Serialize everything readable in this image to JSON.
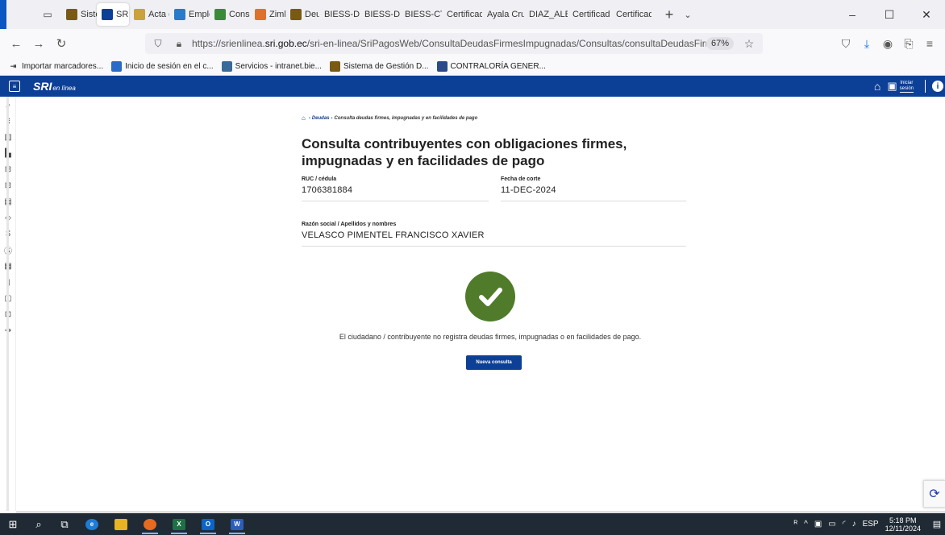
{
  "browser": {
    "tabs": [
      {
        "label": "Sistem",
        "icon": "sri-shield-icon",
        "color": "#7a5a12",
        "active": false
      },
      {
        "label": "SRI",
        "icon": "sri-logo-icon",
        "color": "#0c3f96",
        "active": true
      },
      {
        "label": "Acta c",
        "icon": "feather-icon",
        "color": "#c9a23a",
        "active": false
      },
      {
        "label": "Emple",
        "icon": "people-icon",
        "color": "#2a7ac9",
        "active": false
      },
      {
        "label": "Consu",
        "icon": "arrows-icon",
        "color": "#3a8a3a",
        "active": false
      },
      {
        "label": "Zimbr",
        "icon": "zimbra-icon",
        "color": "#e0712a",
        "active": false
      },
      {
        "label": "Deud",
        "icon": "sri-shield-icon",
        "color": "#7a5a12",
        "active": false
      },
      {
        "label": "BIESS-DG",
        "icon": "",
        "color": "",
        "active": false
      },
      {
        "label": "BIESS-DG",
        "icon": "",
        "color": "",
        "active": false
      },
      {
        "label": "BIESS-CTE",
        "icon": "",
        "color": "",
        "active": false
      },
      {
        "label": "Certificad",
        "icon": "",
        "color": "",
        "active": false
      },
      {
        "label": "Ayala Cru",
        "icon": "",
        "color": "",
        "active": false
      },
      {
        "label": "DIAZ_ALB",
        "icon": "",
        "color": "",
        "active": false
      },
      {
        "label": "Certificad",
        "icon": "",
        "color": "",
        "active": false
      },
      {
        "label": "Certificad",
        "icon": "",
        "color": "",
        "active": false
      }
    ],
    "url_prefix": "https://srienlinea.",
    "url_domain": "sri.gob.ec",
    "url_path": "/sri-en-linea/SriPagosWeb/ConsultaDeudasFirmesImpugnadas/Consultas/consultaDeudasFirmesImpugnadas",
    "zoom": "67%",
    "bookmarks": [
      {
        "label": "Importar marcadores...",
        "icon": "import-icon",
        "color": ""
      },
      {
        "label": "Inicio de sesión en el c...",
        "icon": "zimbra-icon",
        "color": "#2a6ac9"
      },
      {
        "label": "Servicios - intranet.bie...",
        "icon": "folder-icon",
        "color": "#3a6a9a"
      },
      {
        "label": "Sistema de Gestión D...",
        "icon": "sri-shield-icon",
        "color": "#7a5a12"
      },
      {
        "label": "CONTRALORÍA GENER...",
        "icon": "contraloria-icon",
        "color": "#2a4a8a"
      }
    ]
  },
  "sri": {
    "logo": "SRI",
    "logo_sub": "en línea",
    "login_label_1": "Iniciar",
    "login_label_2": "sesión"
  },
  "content": {
    "breadcrumb": {
      "parent": "Deudas",
      "current": "Consulta deudas firmes, impugnadas y en facilidades de pago"
    },
    "title": "Consulta contribuyentes con obligaciones firmes, impugnadas y en facilidades de pago",
    "ruc_label": "RUC / cédula",
    "ruc_value": "1706381884",
    "fecha_label": "Fecha de corte",
    "fecha_value": "11-DEC-2024",
    "razon_label": "Razón social / Apellidos y nombres",
    "razon_value": "VELASCO PIMENTEL FRANCISCO XAVIER",
    "message": "El ciudadano / contribuyente no registra deudas firmes, impugnadas o en facilidades de pago.",
    "button": "Nueva consulta",
    "success_color": "#4f7b2a",
    "brand_color": "#0c3f96"
  },
  "taskbar": {
    "lang": "ESP",
    "time": "5:18 PM",
    "date": "12/11/2024"
  }
}
